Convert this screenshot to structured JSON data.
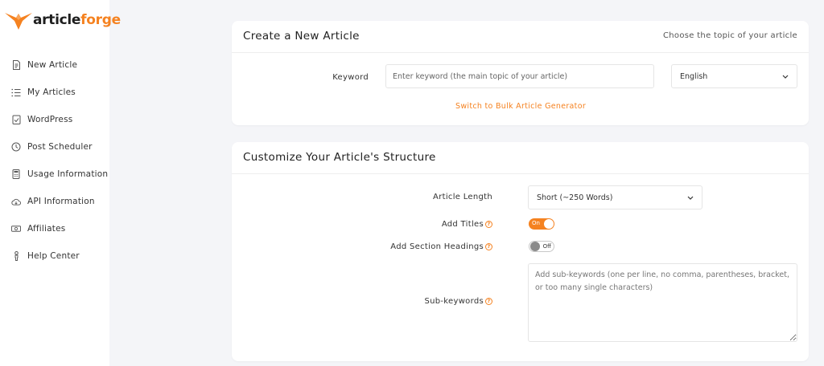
{
  "brand": {
    "part1": "article",
    "part2": "forge",
    "color": "#f58220"
  },
  "sidebar": {
    "items": [
      {
        "label": "New Article",
        "icon": "document-icon"
      },
      {
        "label": "My Articles",
        "icon": "list-icon"
      },
      {
        "label": "WordPress",
        "icon": "checklist-icon"
      },
      {
        "label": "Post Scheduler",
        "icon": "clock-icon"
      },
      {
        "label": "Usage Information",
        "icon": "calculator-icon"
      },
      {
        "label": "API Information",
        "icon": "cloud-icon"
      },
      {
        "label": "Affiliates",
        "icon": "money-icon"
      },
      {
        "label": "Help Center",
        "icon": "person-icon"
      }
    ]
  },
  "create": {
    "title": "Create a New Article",
    "subtitle": "Choose the topic of your article",
    "keyword_label": "Keyword",
    "keyword_value": "",
    "keyword_placeholder": "Enter keyword (the main topic of your article)",
    "language_value": "English",
    "bulk_link": "Switch to Bulk Article Generator"
  },
  "structure": {
    "title": "Customize Your Article's Structure",
    "length_label": "Article Length",
    "length_value": "Short (~250 Words)",
    "titles_label": "Add Titles",
    "titles_toggle": "On",
    "headings_label": "Add Section Headings",
    "headings_toggle": "Off",
    "subkeywords_label": "Sub-keywords",
    "subkeywords_placeholder": "Add sub-keywords (one per line, no comma, parentheses, bracket, or too many single characters)",
    "help_glyph": "?"
  }
}
